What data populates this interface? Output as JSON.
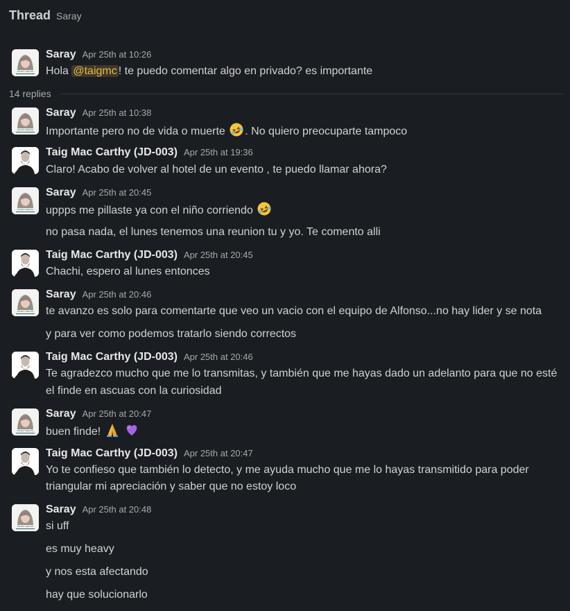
{
  "header": {
    "title": "Thread",
    "channel": "Saray"
  },
  "parent": {
    "author": "Saray",
    "time": "Apr 25th at 10:26",
    "text_before": "Hola ",
    "mention": "@taigmc",
    "text_after": "! te puedo comentar algo en privado? es importante"
  },
  "replies_label": "14 replies",
  "messages": [
    {
      "author": "Saray",
      "time": "Apr 25th at 10:38",
      "l1a": "Importante pero no de vida o muerte ",
      "l1b": ". No quiero preocuparte tampoco",
      "emoji": "rofl"
    },
    {
      "author": "Taig Mac Carthy (JD-003)",
      "time": "Apr 25th at 19:36",
      "l1": "Claro! Acabo de volver al hotel de un evento , te puedo llamar ahora?"
    },
    {
      "author": "Saray",
      "time": "Apr 25th at 20:45",
      "l1a": "uppps me pillaste ya con el niño corriendo ",
      "emoji": "rofl",
      "l2": "no pasa nada, el lunes tenemos una reunion tu y yo. Te comento alli"
    },
    {
      "author": "Taig Mac Carthy (JD-003)",
      "time": "Apr 25th at 20:45",
      "l1": "Chachi, espero al lunes entonces"
    },
    {
      "author": "Saray",
      "time": "Apr 25th at 20:46",
      "l1": "te avanzo es solo para comentarte que veo un vacio con el equipo de Alfonso...no hay lider y se nota",
      "l2": "y para ver como podemos tratarlo siendo correctos"
    },
    {
      "author": "Taig Mac Carthy (JD-003)",
      "time": "Apr 25th at 20:46",
      "l1": "Te agradezco mucho que me lo transmitas, y también que me hayas dado un adelanto para que no esté",
      "l2": "el finde en ascuas con la curiosidad"
    },
    {
      "author": "Saray",
      "time": "Apr 25th at 20:47",
      "l1": "buen finde! ",
      "emoji": "pray-heart"
    },
    {
      "author": "Taig Mac Carthy (JD-003)",
      "time": "Apr 25th at 20:47",
      "l1": "Yo te confieso que también lo detecto, y me ayuda mucho que me lo hayas transmitido para poder",
      "l2": "triangular mi apreciación y saber que no estoy loco"
    },
    {
      "author": "Saray",
      "time": "Apr 25th at 20:48",
      "l1": "si uff",
      "l2": "es muy heavy",
      "l3": "y nos esta afectando",
      "l4": "hay que solucionarlo"
    }
  ],
  "avatar_logo_text": "TALENT HEALTH",
  "colors": {
    "background": "#1a1d21",
    "mention": "#e8b84a",
    "text": "#d1d2d3"
  }
}
